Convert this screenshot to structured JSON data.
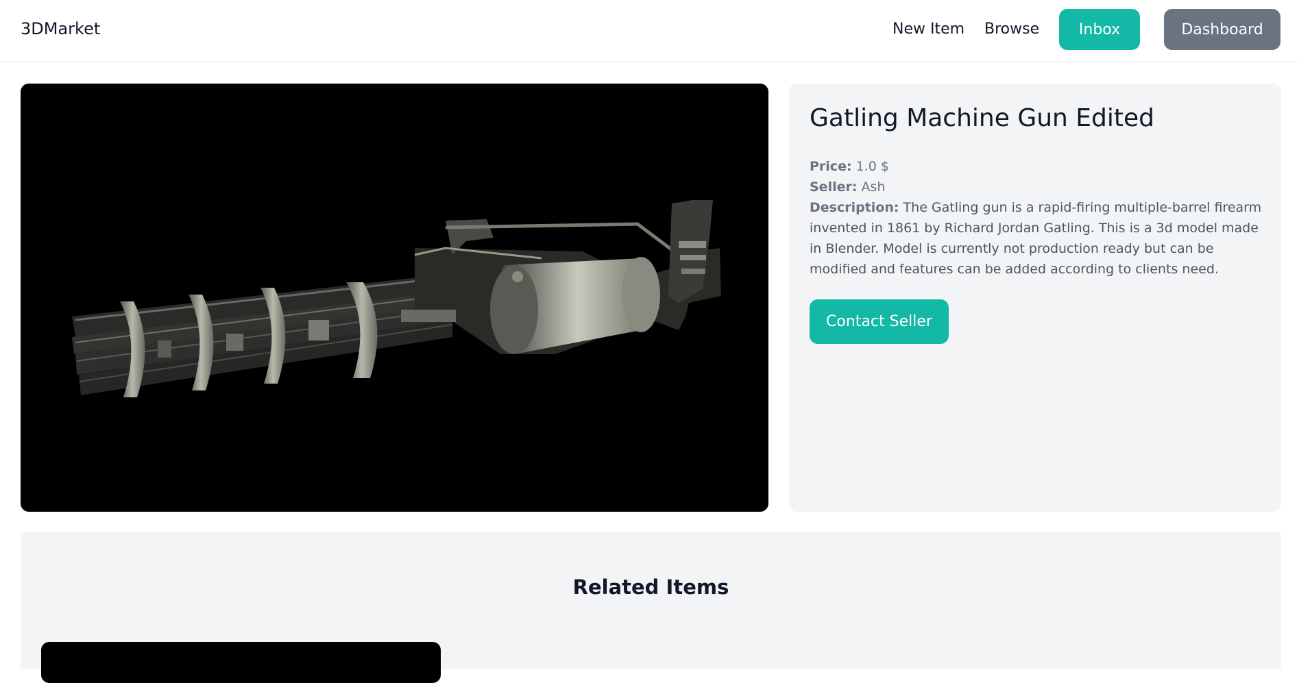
{
  "nav": {
    "brand": "3DMarket",
    "new_item": "New Item",
    "browse": "Browse",
    "inbox": "Inbox",
    "dashboard": "Dashboard"
  },
  "item": {
    "title": "Gatling Machine Gun Edited",
    "price_label": "Price:",
    "price_value": "1.0 $",
    "seller_label": "Seller:",
    "seller_value": "Ash",
    "description_label": "Description:",
    "description_value": "The Gatling gun is a rapid-firing multiple-barrel firearm invented in 1861 by Richard Jordan Gatling. This is a 3d model made in Blender. Model is currently not production ready but can be modified and features can be added according to clients need.",
    "contact_button": "Contact Seller"
  },
  "related": {
    "title": "Related Items"
  },
  "colors": {
    "accent": "#14b8a6",
    "dashboard_button": "#6b7280",
    "panel_bg": "#f3f4f6",
    "viewer_bg": "#000000"
  }
}
